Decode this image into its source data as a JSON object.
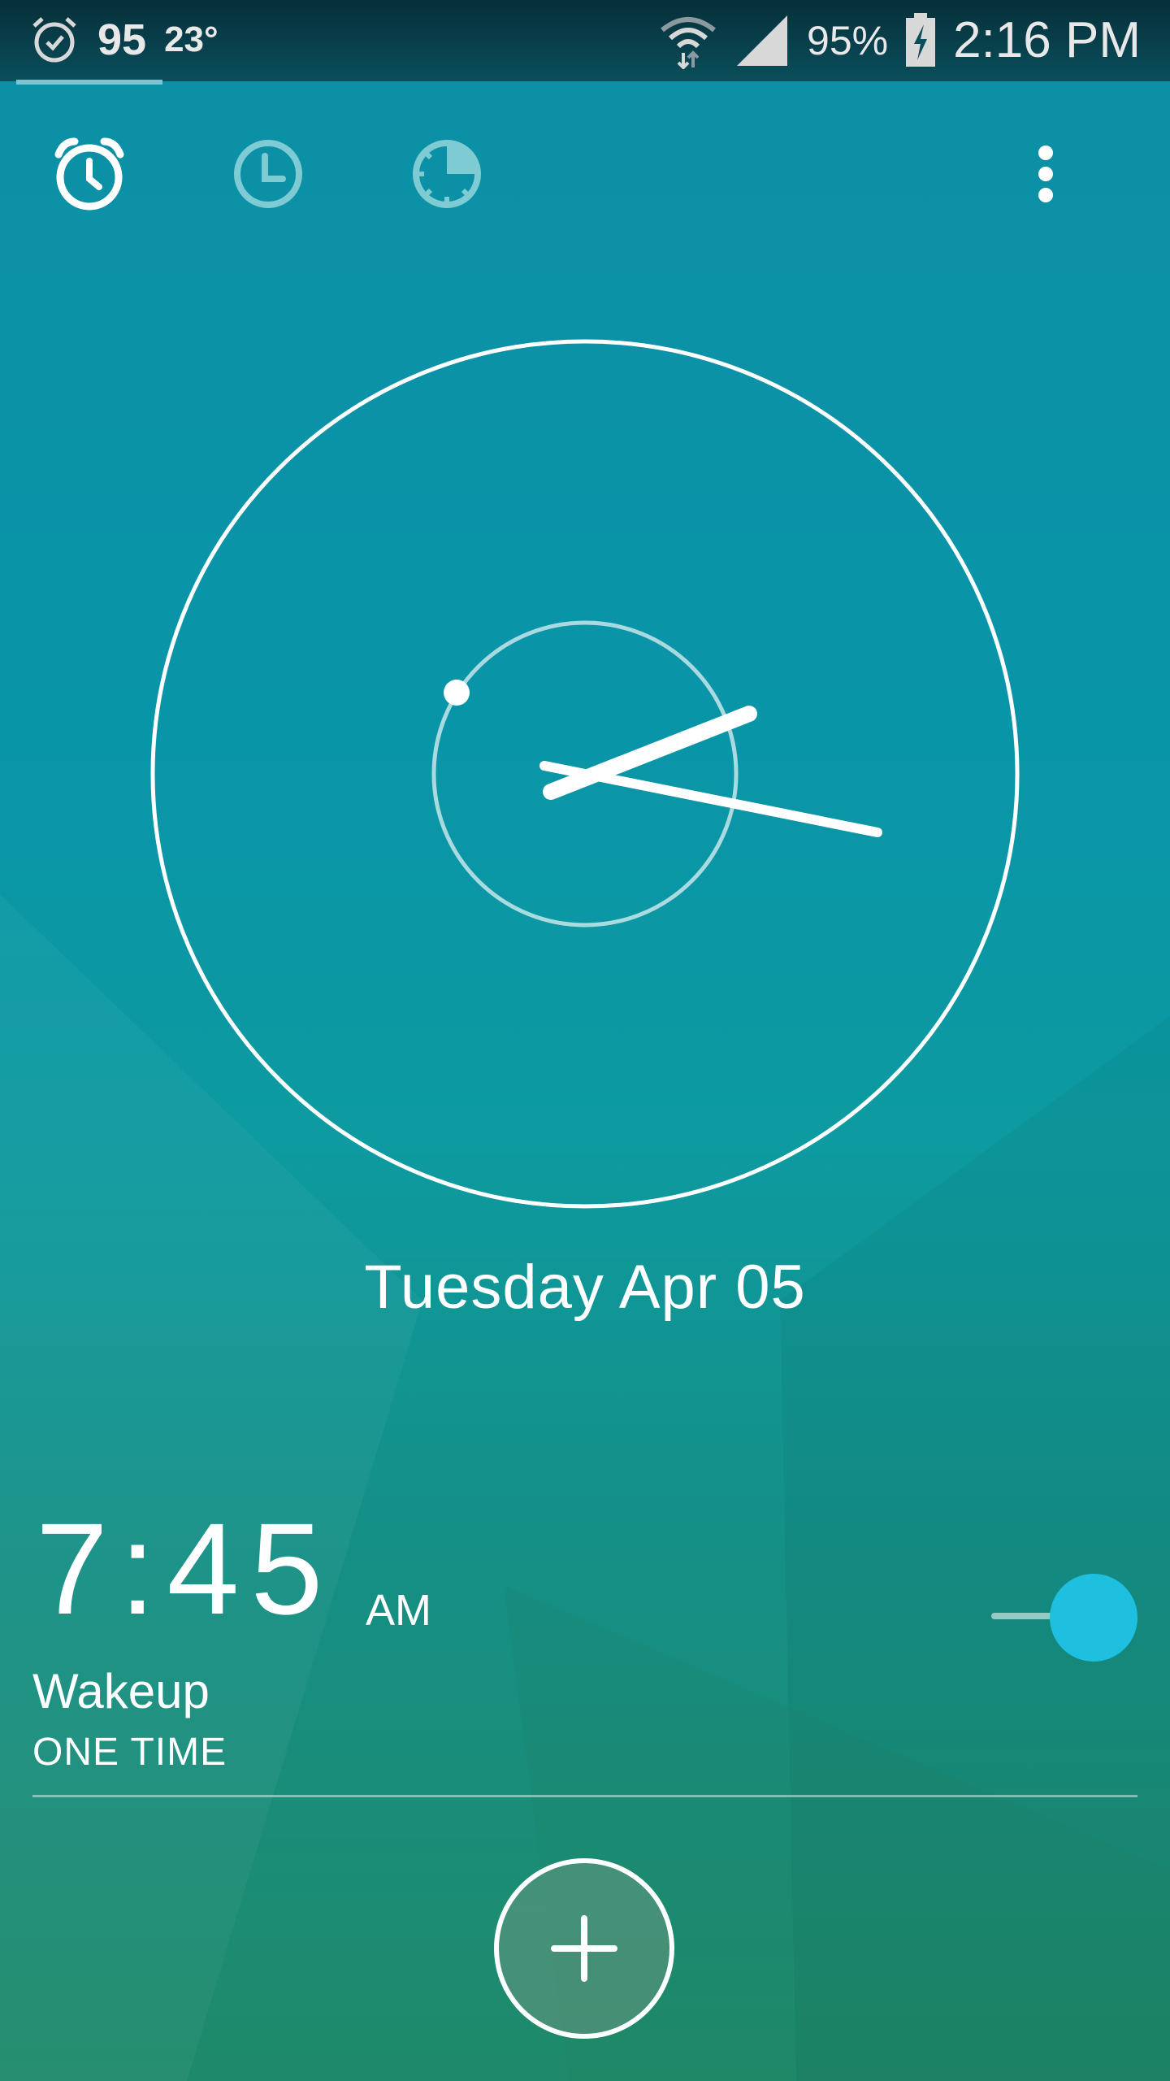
{
  "status_bar": {
    "icons": [
      "alarm-icon",
      "wifi-icon",
      "signal-icon",
      "battery-charging-icon"
    ],
    "notification_count": "95",
    "temperature": "23°",
    "battery_percent": "95%",
    "time": "2:16 PM"
  },
  "tabs": [
    {
      "name": "alarm",
      "icon": "alarm-clock-icon",
      "active": true
    },
    {
      "name": "world-clock",
      "icon": "clock-icon",
      "active": false
    },
    {
      "name": "timer",
      "icon": "timer-icon",
      "active": false
    }
  ],
  "menu_icon": "more-vert-icon",
  "clock": {
    "time": "2:16",
    "hour": 2,
    "minute": 16,
    "second": 0
  },
  "date": "Tuesday Apr 05",
  "alarm": {
    "time": "7:45",
    "ampm": "AM",
    "label": "Wakeup",
    "repeat": "ONE TIME",
    "enabled": true
  },
  "fab_icon": "add-icon",
  "colors": {
    "accent": "#1fbfe0",
    "background_top": "#0d8fa6",
    "background_bottom": "#1f8a6a"
  }
}
